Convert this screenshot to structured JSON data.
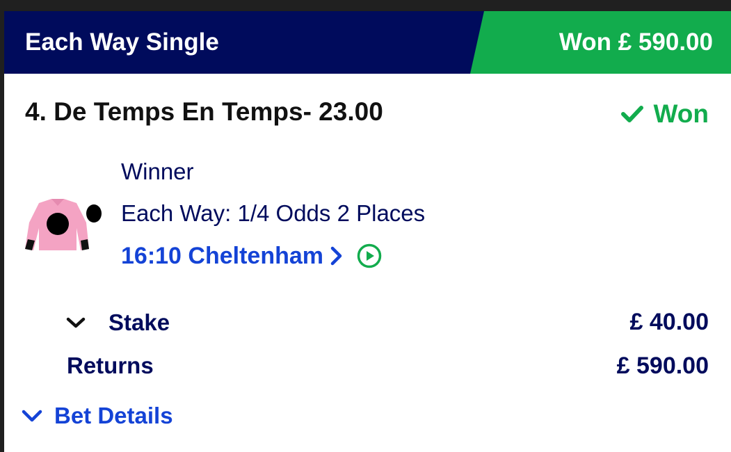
{
  "header": {
    "title": "Each Way Single",
    "status_banner": "Won £ 590.00"
  },
  "selection": {
    "title": "4. De Temps En Temps- 23.00",
    "result": "Won",
    "market": "Winner",
    "each_way_terms": "Each Way: 1/4 Odds 2 Places",
    "race_link": "16:10 Cheltenham"
  },
  "stake": {
    "label": "Stake",
    "value": "£ 40.00"
  },
  "returns": {
    "label": "Returns",
    "value": "£ 590.00"
  },
  "bet_details": {
    "label": "Bet Details"
  },
  "icons": {
    "result": "check-icon",
    "race_link": "chevron-right-icon",
    "race_video": "play-circle-icon",
    "stake_toggle": "chevron-down-icon",
    "bet_details_toggle": "chevron-down-icon",
    "silks": "jockey-silks-icon"
  },
  "colors": {
    "header_bg": "#000b5c",
    "won_green": "#12ac4d",
    "link_blue": "#1443d6",
    "text_navy": "#000b5c",
    "silks_pink": "#f4a3c3"
  }
}
